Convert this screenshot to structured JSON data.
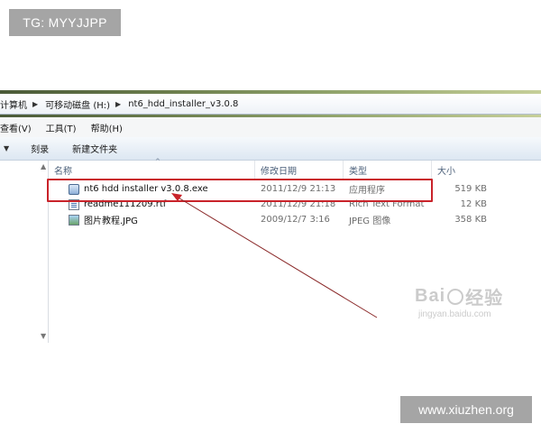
{
  "watermark_tag": "TG: MYYJJPP",
  "watermark_site": "www.xiuzhen.org",
  "baidu_watermark": {
    "brand": "Bai",
    "brand2": "经验",
    "domain": "jingyan.baidu.com"
  },
  "address_bar": {
    "crumbs": [
      "计算机",
      "可移动磁盘 (H:)",
      "nt6_hdd_installer_v3.0.8"
    ]
  },
  "menu": [
    "查看(V)",
    "工具(T)",
    "帮助(H)"
  ],
  "toolbar": {
    "burn": "刻录",
    "new_folder": "新建文件夹"
  },
  "columns": {
    "name": "名称",
    "date": "修改日期",
    "type": "类型",
    "size": "大小"
  },
  "files": [
    {
      "name": "nt6 hdd installer v3.0.8.exe",
      "date": "2011/12/9 21:13",
      "type": "应用程序",
      "size": "519 KB",
      "icon": "exe-icon"
    },
    {
      "name": "readme111209.rtf",
      "date": "2011/12/9 21:18",
      "type": "Rich Text Format",
      "size": "12 KB",
      "icon": "rtf-icon"
    },
    {
      "name": "图片教程.JPG",
      "date": "2009/12/7 3:16",
      "type": "JPEG 图像",
      "size": "358 KB",
      "icon": "jpg-icon"
    }
  ],
  "colors": {
    "highlight": "#c9232a",
    "arrow": "#8b2a2a"
  }
}
